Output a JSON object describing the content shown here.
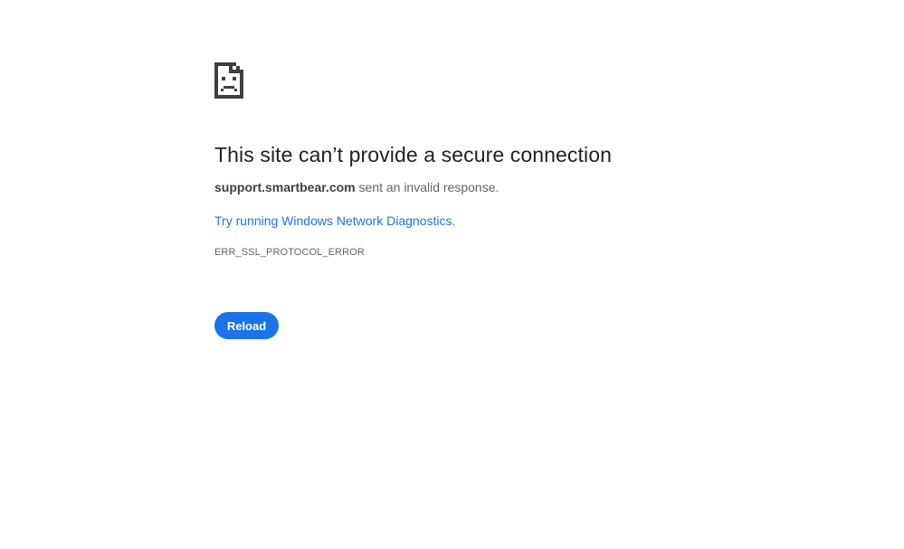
{
  "error_page": {
    "icon": "sad-page-icon",
    "headline": "This site can’t provide a secure connection",
    "host": "support.smartbear.com",
    "summary_suffix": " sent an invalid response.",
    "suggestion_link": "Try running Windows Network Diagnostics",
    "suggestion_suffix": ".",
    "error_code": "ERR_SSL_PROTOCOL_ERROR",
    "reload_label": "Reload"
  },
  "colors": {
    "accent": "#1a73e8",
    "headline": "#202124",
    "secondary_text": "#5f6368",
    "icon": "#3c4043",
    "background": "#ffffff"
  }
}
